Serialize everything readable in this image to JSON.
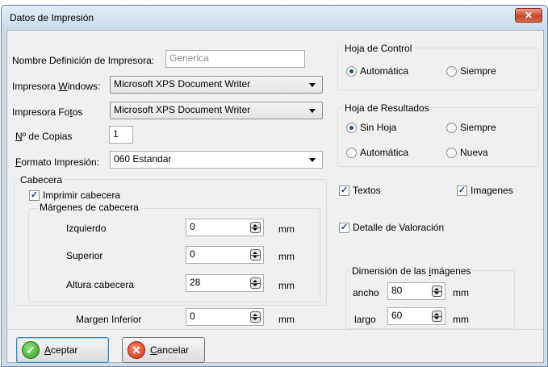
{
  "window": {
    "title": "Datos de Impresión",
    "close_glyph": "✕"
  },
  "printer_def": {
    "label": "Nombre Definición de Impresora:",
    "value": "Generica"
  },
  "windows_printer": {
    "label_pre": "Impresora ",
    "label_key": "W",
    "label_post": "indows:",
    "value": "Microsoft XPS Document Writer"
  },
  "photo_printer": {
    "label_pre": "Impresora Fo",
    "label_key": "t",
    "label_post": "os",
    "value": "Microsoft XPS Document Writer"
  },
  "copies": {
    "label_key": "N",
    "label_post": "º de Copias",
    "value": "1"
  },
  "format": {
    "label_key": "F",
    "label_post": "ormato Impresión:",
    "value": "060 Estandar"
  },
  "header_group": {
    "legend": "Cabecera",
    "print_header_label": "Imprimir cabecera",
    "print_header_checked": true,
    "margins_legend": "Márgenes de cabecera",
    "left_label": "Izquierdo",
    "left_value": "0",
    "left_unit": "mm",
    "top_label": "Superior",
    "top_value": "0",
    "top_unit": "mm",
    "height_label": "Altura cabecera",
    "height_value": "28",
    "height_unit": "mm"
  },
  "bottom_margin": {
    "label": "Margen Inferior",
    "value": "0",
    "unit": "mm"
  },
  "control_sheet": {
    "legend": "Hoja de Control",
    "options": [
      "Automática",
      "Siempre"
    ],
    "selected": "Automática"
  },
  "results_sheet": {
    "legend": "Hoja de Resultados",
    "options": [
      "Sin Hoja",
      "Siempre",
      "Automática",
      "Nueva"
    ],
    "selected": "Sin Hoja"
  },
  "checks": {
    "texts_label": "Textos",
    "texts_checked": true,
    "images_label": "Imagenes",
    "images_checked": true,
    "detail_label": "Detalle de Valoración",
    "detail_checked": true
  },
  "image_dims": {
    "legend_pre": "Dimensión de las ",
    "legend_key": "i",
    "legend_post": "mágenes",
    "width_label": "ancho",
    "width_value": "80",
    "width_unit": "mm",
    "length_label": "largo",
    "length_value": "60",
    "length_unit": "mm"
  },
  "buttons": {
    "accept_key": "A",
    "accept_post": "ceptar",
    "cancel_key": "C",
    "cancel_post": "ancelar"
  },
  "check_glyph": "✓",
  "icons": {
    "accept": "check-circle-icon",
    "cancel": "x-circle-icon"
  },
  "colors": {
    "title_bg": "#c9d9ec",
    "close_red": "#c7442b",
    "accept_green": "#2e9b1f",
    "cancel_red": "#d02a10"
  }
}
